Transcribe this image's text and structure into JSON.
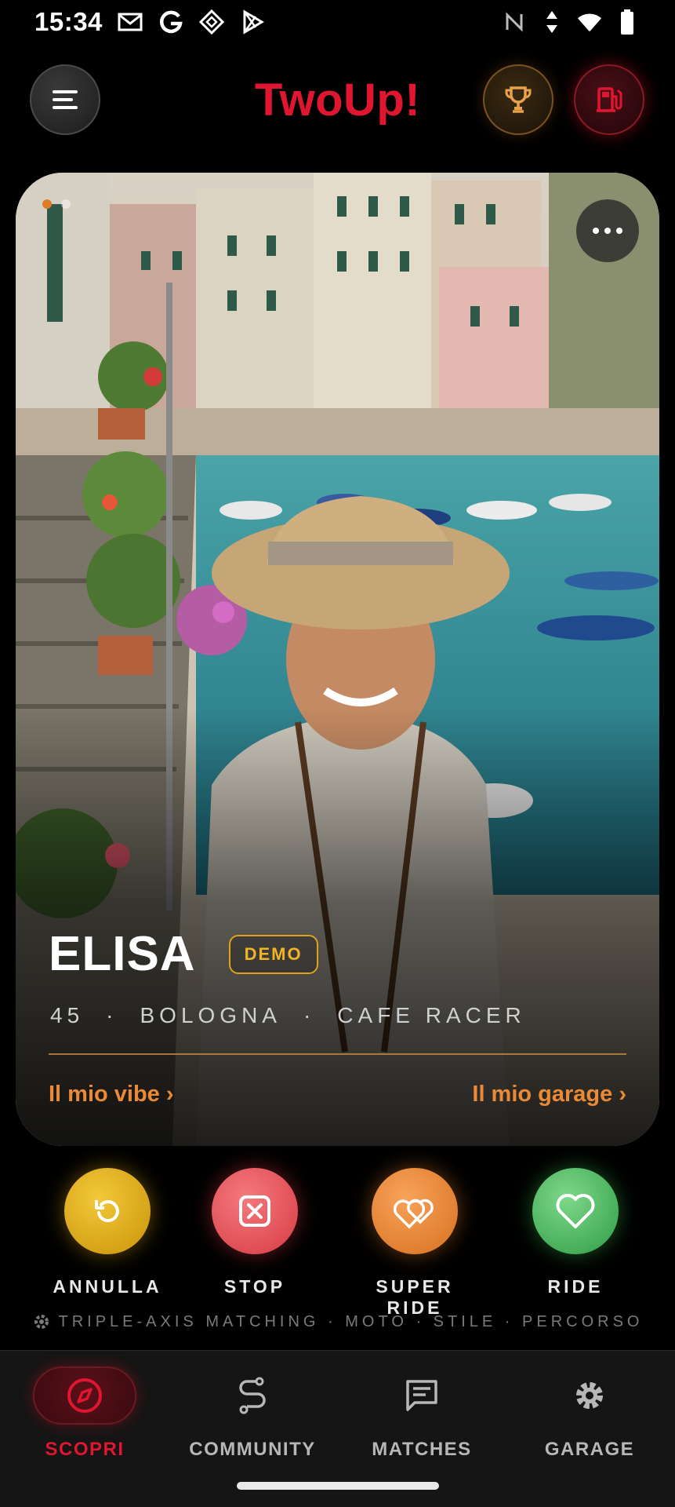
{
  "status_bar": {
    "time": "15:34",
    "left_icons": [
      "gmail-icon",
      "google-icon",
      "app-diamond-icon",
      "play-store-icon"
    ],
    "right_icons": [
      "nfc-icon",
      "data-arrows-icon",
      "wifi-icon",
      "battery-icon"
    ],
    "wifi_badge": "4"
  },
  "header": {
    "title": "TwoUp!",
    "title_color": "#e01630",
    "menu_icon": "menu-icon",
    "trophy_icon": "trophy-icon",
    "fuel_icon": "fuel-pump-icon"
  },
  "profile": {
    "name": "ELISA",
    "badge": "DEMO",
    "age": "45",
    "city": "BOLOGNA",
    "style": "CAFE RACER",
    "separator": "·",
    "vibe_link": "Il mio vibe ›",
    "garage_link": "Il mio garage ›",
    "photo_count": 2,
    "active_photo": 1
  },
  "actions": [
    {
      "label": "ANNULLA",
      "icon": "undo-icon",
      "color": "#e3a814"
    },
    {
      "label": "STOP",
      "icon": "close-box-icon",
      "color": "#e4545b"
    },
    {
      "label": "SUPER RIDE",
      "icon": "double-heart-icon",
      "color": "#ec8a3a"
    },
    {
      "label": "RIDE",
      "icon": "heart-icon",
      "color": "#4cbb5e"
    }
  ],
  "tagline": "TRIPLE-AXIS MATCHING · MOTO · STILE · PERCORSO",
  "nav": [
    {
      "label": "SCOPRI",
      "icon": "compass-icon",
      "active": true
    },
    {
      "label": "COMMUNITY",
      "icon": "route-icon",
      "active": false
    },
    {
      "label": "MATCHES",
      "icon": "chat-icon",
      "active": false
    },
    {
      "label": "GARAGE",
      "icon": "gear-icon",
      "active": false
    }
  ],
  "colors": {
    "accent": "#e01630",
    "orange": "#ea8a36",
    "badge": "#f0b428"
  }
}
